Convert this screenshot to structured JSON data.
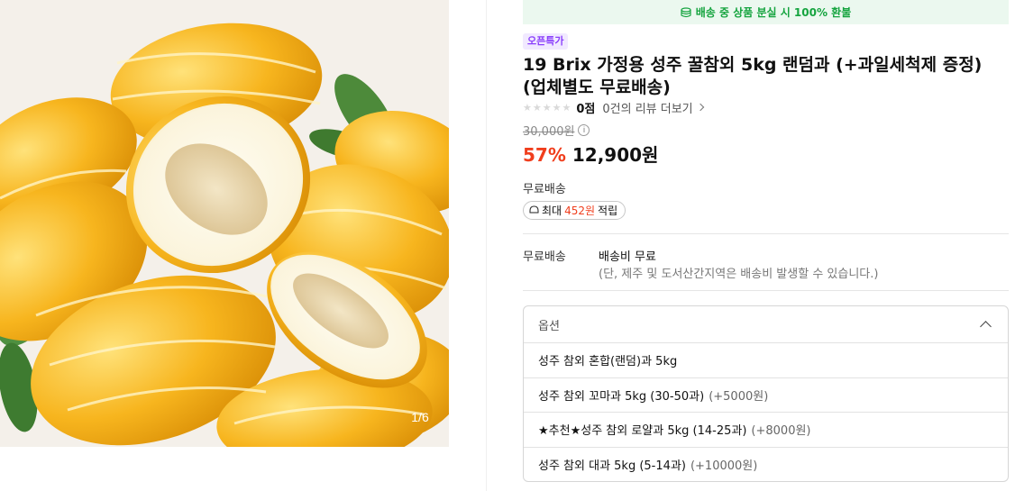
{
  "gallery": {
    "counter": "1/6"
  },
  "banner": {
    "text": "배송 중 상품 분실 시 100% 환불",
    "icon": "coin-stack-icon"
  },
  "product": {
    "tag": "오픈특가",
    "title": "19 Brix 가정용 성주 꿀참외 5kg 랜덤과 (+과일세척제 증정) (업체별도 무료배송)",
    "rating": {
      "stars": 0,
      "score": "0점",
      "review_link": "0건의 리뷰 더보기"
    },
    "original_price": "30,000원",
    "discount": "57%",
    "sale_price": "12,900원"
  },
  "shipping": {
    "summary_label": "무료배송",
    "points_prefix": "최대",
    "points_amount": "452원",
    "points_suffix": "적립",
    "row_label": "무료배송",
    "fee": "배송비 무료",
    "note": "(단, 제주 및 도서산간지역은 배송비 발생할 수 있습니다.)"
  },
  "options": {
    "header": "옵션",
    "items": [
      {
        "label": "성주 참외 혼합(랜덤)과 5kg",
        "extra": ""
      },
      {
        "label": "성주 참외 꼬마과 5kg (30-50과)",
        "extra": "(+5000원)"
      },
      {
        "label": "★추천★성주 참외 로얄과 5kg (14-25과)",
        "extra": "(+8000원)"
      },
      {
        "label": "성주 참외 대과 5kg (5-14과)",
        "extra": "(+10000원)"
      }
    ]
  },
  "colors": {
    "discount": "#f03e1d",
    "banner_green": "#15a43f",
    "tag_purple": "#8a3ffc",
    "melon_yellow": "#f7b51e"
  }
}
